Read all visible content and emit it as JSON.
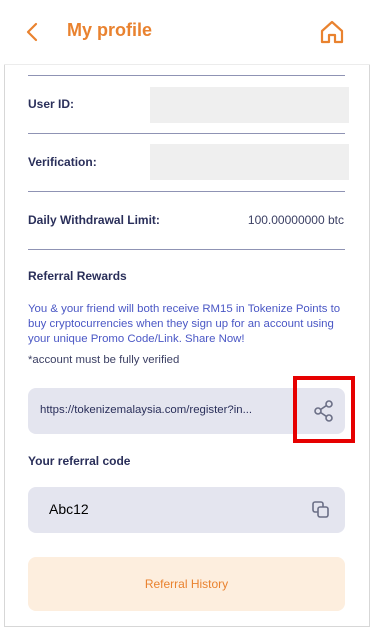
{
  "header": {
    "title": "My profile"
  },
  "profile": {
    "user_id_label": "User ID:",
    "verification_label": "Verification:",
    "withdrawal_label": "Daily Withdrawal Limit:",
    "withdrawal_value": "100.00000000 btc"
  },
  "referral": {
    "section_title": "Referral Rewards",
    "info": "You & your friend will both receive RM15 in Tokenize Points to buy cryptocurrencies when they sign up for an account using your unique Promo Code/Link. Share Now!",
    "note": "*account must be fully verified",
    "link": "https://tokenizemalaysia.com/register?in...",
    "code_label": "Your referral code",
    "code_value": "Abc12",
    "history_button": "Referral History"
  },
  "colors": {
    "accent": "#e9822f",
    "info_text": "#4a57c5",
    "highlight": "#e60000"
  },
  "icons": {
    "back": "chevron-left-icon",
    "home": "home-icon",
    "share": "share-icon",
    "copy": "copy-icon"
  }
}
